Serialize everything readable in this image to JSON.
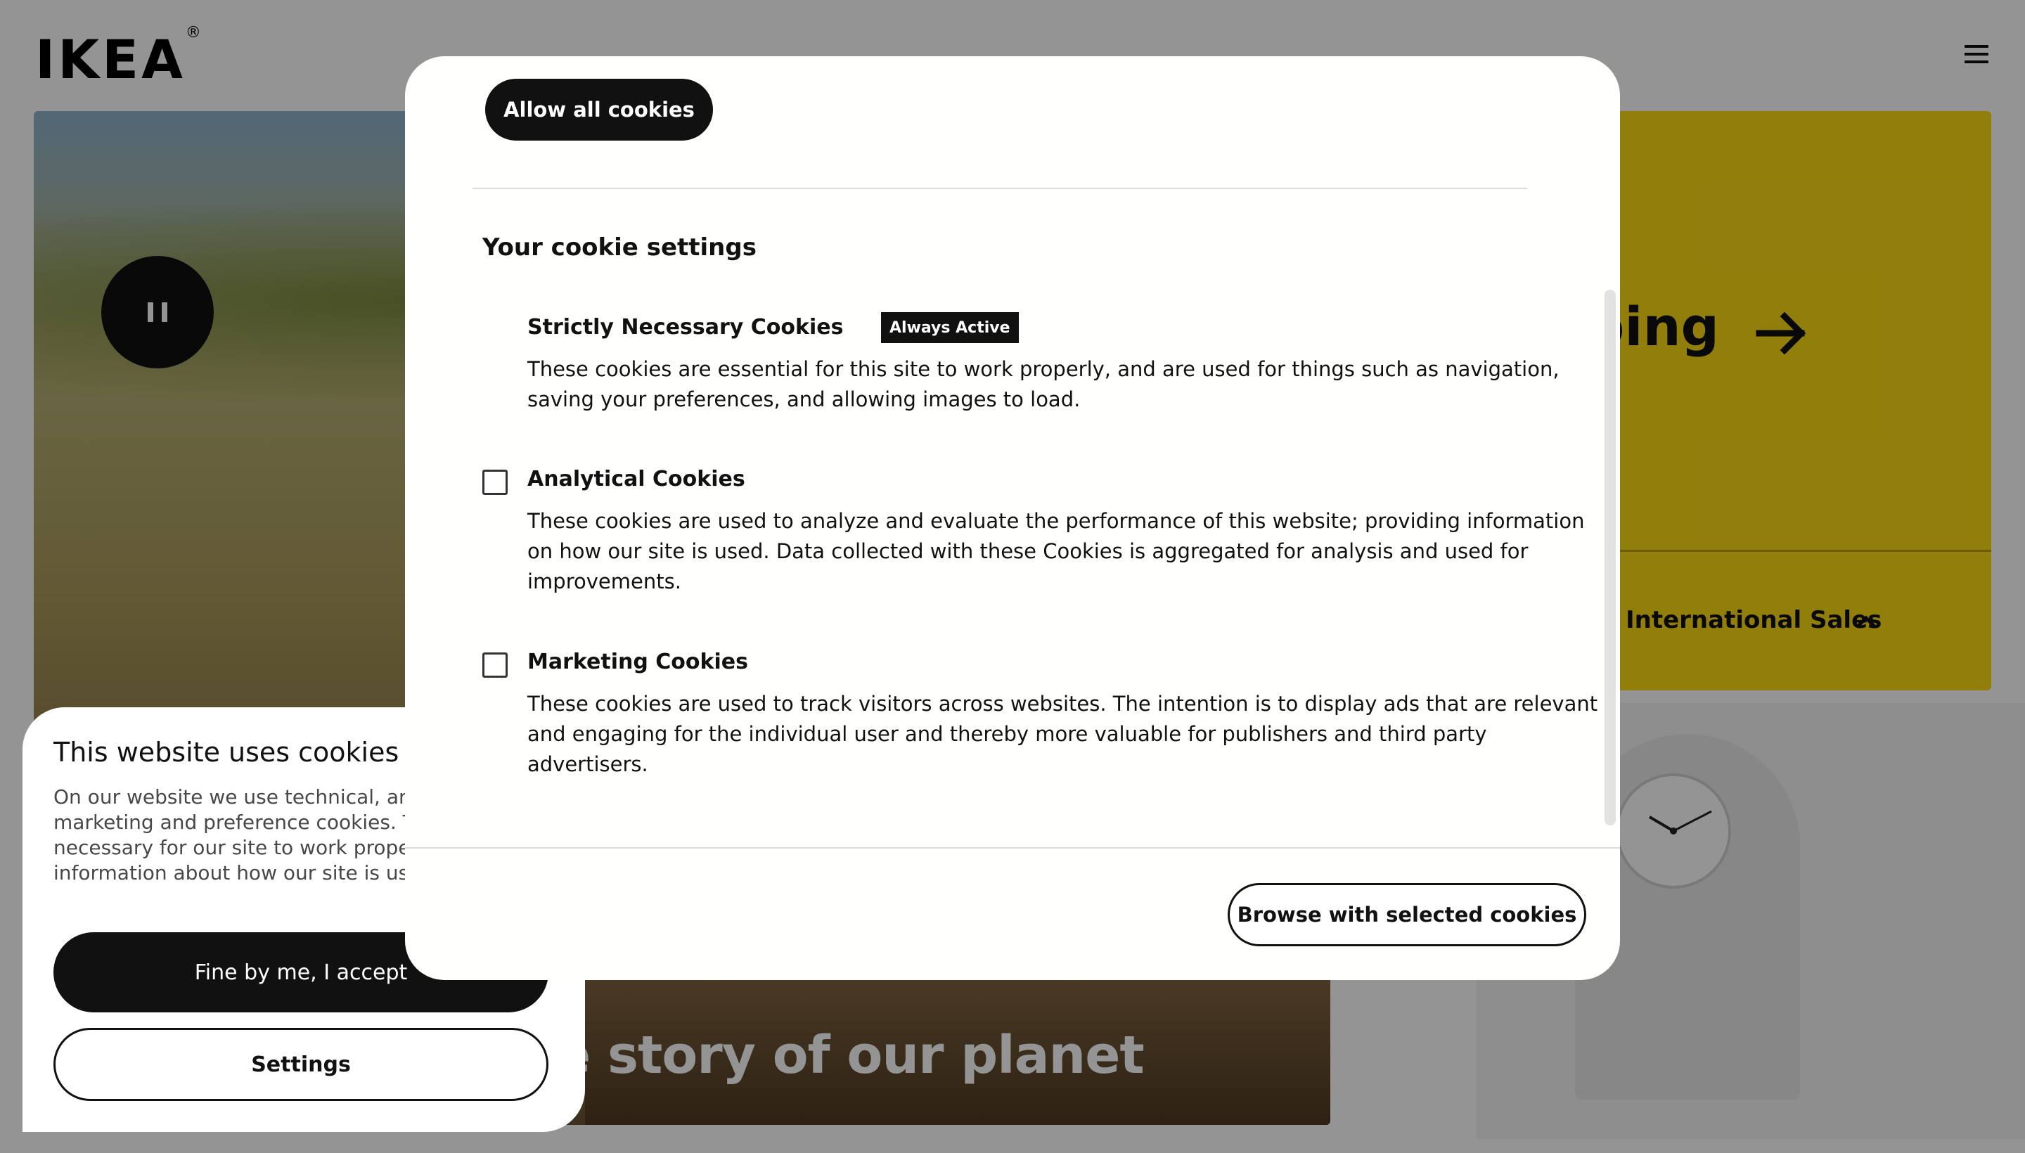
{
  "header": {
    "logo_text": "IKEA",
    "logo_mark": "®",
    "menu_icon": "hamburger-menu-icon"
  },
  "hero": {
    "title": "e story of our planet",
    "pause_icon": "pause-icon"
  },
  "promo": {
    "title": "ping",
    "arrow_icon": "arrow-right-icon",
    "link_label": "International Sales",
    "chevron_icon": "chevron-up-icon",
    "background_color": "#fbd914"
  },
  "banner": {
    "title": "This website uses cookies",
    "text_lines": [
      "On our website we use technical, analy",
      "marketing and preference cookies. Th",
      "necessary for our site to work properly",
      "information about how our site is used"
    ],
    "accept_label": "Fine by me, I accept",
    "settings_label": "Settings"
  },
  "modal": {
    "allow_all_label": "Allow all cookies",
    "settings_heading": "Your cookie settings",
    "sections": [
      {
        "title": "Strictly Necessary Cookies",
        "badge": "Always Active",
        "desc_lines": [
          "These cookies are essential for this site to work properly, and are used for things such as navigation,",
          "saving your preferences, and allowing images to load."
        ]
      },
      {
        "title": "Analytical Cookies",
        "checked": false,
        "desc_lines": [
          "These cookies are used to analyze and evaluate the performance of this website; providing information",
          "on how our site is used. Data collected with these Cookies is aggregated for analysis and used for",
          "improvements."
        ]
      },
      {
        "title": "Marketing Cookies",
        "checked": false,
        "desc_lines": [
          "These cookies are used to track visitors across websites. The intention is to display ads that are relevant",
          "and engaging for the individual user and thereby more valuable for publishers and third party",
          "advertisers."
        ]
      }
    ],
    "browse_label": "Browse with selected cookies"
  }
}
